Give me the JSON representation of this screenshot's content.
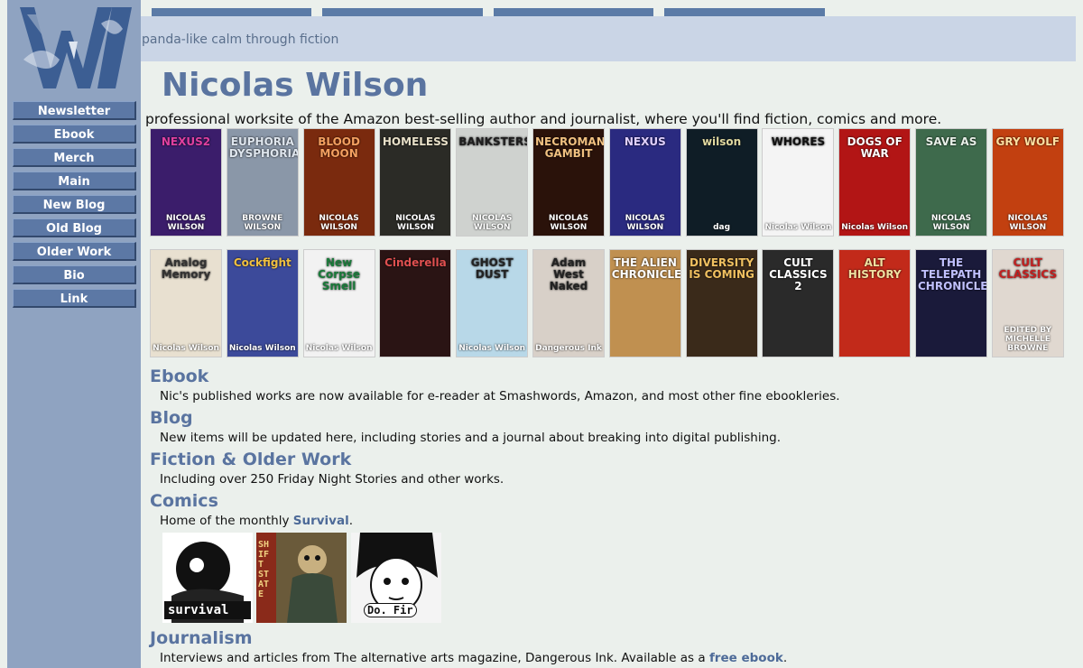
{
  "site": {
    "tagline": "panda-like calm through fiction",
    "title": "Nicolas Wilson",
    "subtitle": "professional worksite of the Amazon best-selling author and journalist, where you'll find fiction, comics and more."
  },
  "nav": [
    "Newsletter",
    "Ebook",
    "Merch",
    "Main",
    "New Blog",
    "Old Blog",
    "Older Work",
    "Bio",
    "Link"
  ],
  "covers": [
    {
      "title": "NEXUS2",
      "author": "NICOLAS WILSON",
      "bg": "#3b1d6b",
      "fg": "#e040a0"
    },
    {
      "title": "EUPHORIA DYSPHORIA",
      "author": "BROWNE WILSON",
      "bg": "#8a97a8",
      "fg": "#dfe6ee"
    },
    {
      "title": "BLOOD MOON",
      "author": "NICOLAS WILSON",
      "bg": "#7a2a0e",
      "fg": "#f4a060"
    },
    {
      "title": "HOMELESS",
      "author": "NICOLAS WILSON",
      "bg": "#2b2b26",
      "fg": "#e8e0c8"
    },
    {
      "title": "BANKSTERS",
      "author": "NICOLAS WILSON",
      "bg": "#cfd2cf",
      "fg": "#1e1e1e"
    },
    {
      "title": "NECROMANCER'S GAMBIT",
      "author": "NICOLAS WILSON",
      "bg": "#2a120a",
      "fg": "#f0c080"
    },
    {
      "title": "NEXUS",
      "author": "NICOLAS WILSON",
      "bg": "#2a2a80",
      "fg": "#e0d0ff"
    },
    {
      "title": "wilson",
      "author": "dag",
      "bg": "#0f1d26",
      "fg": "#e0d8a0"
    },
    {
      "title": "WHORES",
      "author": "Nicolas Wilson",
      "bg": "#f4f4f4",
      "fg": "#111111"
    },
    {
      "title": "DOGS OF WAR",
      "author": "Nicolas Wilson",
      "bg": "#b21515",
      "fg": "#ffffff"
    },
    {
      "title": "SAVE AS",
      "author": "NICOLAS WILSON",
      "bg": "#3e6a4c",
      "fg": "#e8f0e8"
    },
    {
      "title": "GRY WOLF",
      "author": "NICOLAS WILSON",
      "bg": "#c24010",
      "fg": "#ffe0a0"
    },
    {
      "title": "Analog Memory",
      "author": "Nicolas Wilson",
      "bg": "#e8e0d0",
      "fg": "#333333"
    },
    {
      "title": "Cockfight",
      "author": "Nicolas Wilson",
      "bg": "#3c4a9a",
      "fg": "#f0c040"
    },
    {
      "title": "New Corpse Smell",
      "author": "Nicolas Wilson",
      "bg": "#f2f2f2",
      "fg": "#1a7a3a"
    },
    {
      "title": "Cinderella",
      "author": "",
      "bg": "#2a1414",
      "fg": "#e05050"
    },
    {
      "title": "GHOST DUST",
      "author": "Nicolas Wilson",
      "bg": "#b8d8e8",
      "fg": "#222222"
    },
    {
      "title": "Adam West Naked",
      "author": "Dangerous Ink",
      "bg": "#d8d0c8",
      "fg": "#222222"
    },
    {
      "title": "THE ALIEN CHRONICLES",
      "author": "",
      "bg": "#c09050",
      "fg": "#ffffff"
    },
    {
      "title": "DIVERSITY IS COMING",
      "author": "",
      "bg": "#3a2a1a",
      "fg": "#f0c060"
    },
    {
      "title": "CULT CLASSICS 2",
      "author": "",
      "bg": "#2a2a2a",
      "fg": "#ffffff"
    },
    {
      "title": "ALT HISTORY",
      "author": "",
      "bg": "#c22a1a",
      "fg": "#f0e0a0"
    },
    {
      "title": "THE TELEPATH CHRONICLES",
      "author": "",
      "bg": "#1a1a3a",
      "fg": "#c0c0ff"
    },
    {
      "title": "CULT CLASSICS",
      "author": "EDITED BY MICHELLE BROWNE",
      "bg": "#e0d8d0",
      "fg": "#c22020"
    }
  ],
  "sections": [
    {
      "head": "Ebook",
      "text": "Nic's published works are now available for e-reader at Smashwords, Amazon, and most other fine ebookleries."
    },
    {
      "head": "Blog",
      "text": "New items will be updated here, including stories and a journal about breaking into digital publishing."
    },
    {
      "head": "Fiction & Older Work",
      "text": "Including over 250 Friday Night Stories and other works."
    },
    {
      "head": "Comics",
      "text_before": "Home of the monthly ",
      "link": "Survival",
      "text_after": "."
    },
    {
      "head": "Journalism",
      "text_before": "Interviews and articles from The alternative arts magazine, Dangerous Ink. Available as a ",
      "link": "free ebook",
      "text_after": "."
    }
  ],
  "comics": [
    {
      "label": "survival",
      "bg": "#ffffff",
      "fg": "#111111"
    },
    {
      "label": "SHIFT STATE",
      "bg": "#8a3a2a",
      "fg": "#e0c060"
    },
    {
      "label": "Do. Fir",
      "bg": "#f4f4f4",
      "fg": "#111111"
    }
  ],
  "colors": {
    "accent": "#5a74a0",
    "sidebar": "#8fa3c1",
    "nav_button": "#5c78a5",
    "page_bg": "#ebf0ec",
    "topbar": "#cad5e6"
  }
}
